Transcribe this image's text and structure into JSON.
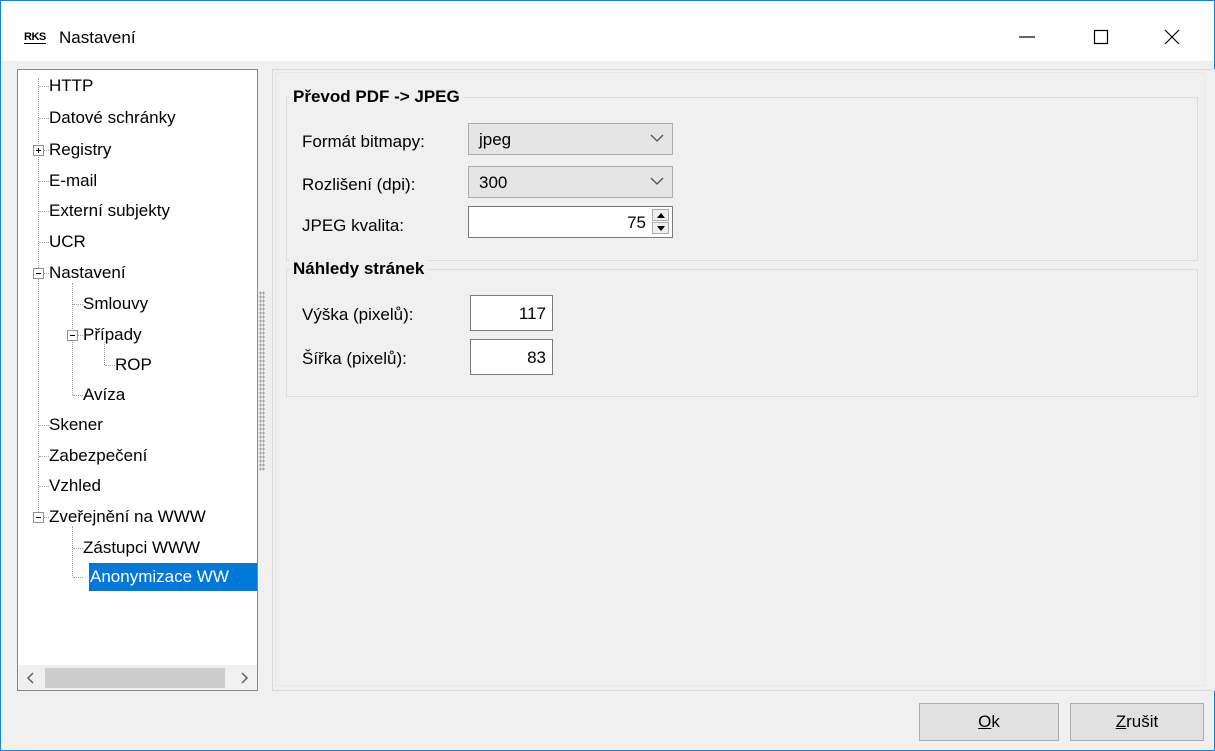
{
  "window": {
    "logo": "RKS",
    "title": "Nastavení",
    "icons": {
      "minimize": "minimize-icon",
      "maximize": "maximize-icon",
      "close": "close-icon"
    }
  },
  "tree": {
    "items": [
      {
        "label": "HTTP"
      },
      {
        "label": "Datové schránky"
      },
      {
        "label": "Registry"
      },
      {
        "label": "E-mail"
      },
      {
        "label": "Externí subjekty"
      },
      {
        "label": "UCR"
      },
      {
        "label": "Nastavení"
      },
      {
        "label": "Smlouvy"
      },
      {
        "label": "Případy"
      },
      {
        "label": "ROP"
      },
      {
        "label": "Avíza"
      },
      {
        "label": "Skener"
      },
      {
        "label": "Zabezpečení"
      },
      {
        "label": "Vzhled"
      },
      {
        "label": "Zveřejnění na WWW"
      },
      {
        "label": "Zástupci WWW"
      },
      {
        "label": "Anonymizace WW"
      }
    ],
    "selected": "Anonymizace WW",
    "selection_color": "#0078d7"
  },
  "pdf_group": {
    "title": "Převod PDF -> JPEG",
    "format_label": "Formát bitmapy:",
    "format_value": "jpeg",
    "resolution_label": "Rozlišení (dpi):",
    "resolution_value": "300",
    "quality_label": "JPEG kvalita:",
    "quality_value": "75"
  },
  "preview_group": {
    "title": "Náhledy stránek",
    "height_label": "Výška (pixelů):",
    "height_value": "117",
    "width_label": "Šířka (pixelů):",
    "width_value": "83"
  },
  "buttons": {
    "ok_mnemonic": "O",
    "ok_rest": "k",
    "cancel_mnemonic": "Z",
    "cancel_rest": "rušit"
  }
}
